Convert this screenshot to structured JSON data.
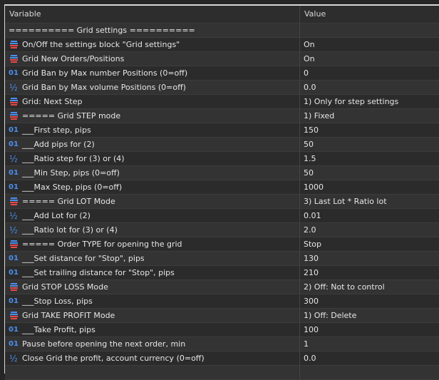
{
  "header": {
    "variable": "Variable",
    "value": "Value"
  },
  "rows": [
    {
      "icon": "none",
      "name": "========== Grid settings ==========",
      "value": ""
    },
    {
      "icon": "enum",
      "name": "On/Off the settings block \"Grid settings\"",
      "value": "On"
    },
    {
      "icon": "enum",
      "name": "Grid New Orders/Positions",
      "value": "On"
    },
    {
      "icon": "int",
      "name": "Grid Ban by Max number Positions (0=off)",
      "value": "0"
    },
    {
      "icon": "double",
      "name": "Grid Ban by Max volume Positions (0=off)",
      "value": "0.0"
    },
    {
      "icon": "enum",
      "name": "Grid: Next Step",
      "value": "1) Only for step settings"
    },
    {
      "icon": "enum",
      "name": "===== Grid STEP mode",
      "value": "1) Fixed"
    },
    {
      "icon": "int",
      "name": "___First step, pips",
      "value": "150"
    },
    {
      "icon": "int",
      "name": "___Add pips for (2)",
      "value": "50"
    },
    {
      "icon": "double",
      "name": "___Ratio step for (3) or (4)",
      "value": "1.5"
    },
    {
      "icon": "int",
      "name": "___Min Step, pips (0=off)",
      "value": "50"
    },
    {
      "icon": "int",
      "name": "___Max Step, pips (0=off)",
      "value": "1000"
    },
    {
      "icon": "enum",
      "name": "===== Grid LOT Mode",
      "value": "3) Last Lot * Ratio lot"
    },
    {
      "icon": "double",
      "name": "___Add Lot for (2)",
      "value": "0.01"
    },
    {
      "icon": "double",
      "name": "___Ratio lot for (3) or (4)",
      "value": "2.0"
    },
    {
      "icon": "enum",
      "name": "===== Order TYPE for opening the grid",
      "value": "Stop"
    },
    {
      "icon": "int",
      "name": "___Set distance for \"Stop\", pips",
      "value": "130"
    },
    {
      "icon": "int",
      "name": "___Set trailing distance for \"Stop\", pips",
      "value": "210"
    },
    {
      "icon": "enum",
      "name": "Grid STOP LOSS Mode",
      "value": "2) Off: Not to control"
    },
    {
      "icon": "int",
      "name": "___Stop Loss, pips",
      "value": "300"
    },
    {
      "icon": "enum",
      "name": "Grid TAKE PROFIT Mode",
      "value": "1) Off: Delete"
    },
    {
      "icon": "int",
      "name": "___Take Profit, pips",
      "value": "100"
    },
    {
      "icon": "int",
      "name": "Pause before opening the next order, min",
      "value": "1"
    },
    {
      "icon": "double",
      "name": "Close Grid the profit, account currency (0=off)",
      "value": "0.0"
    },
    {
      "icon": "none",
      "name": "",
      "value": ""
    }
  ],
  "icons": {
    "int": "01",
    "double": "½"
  }
}
